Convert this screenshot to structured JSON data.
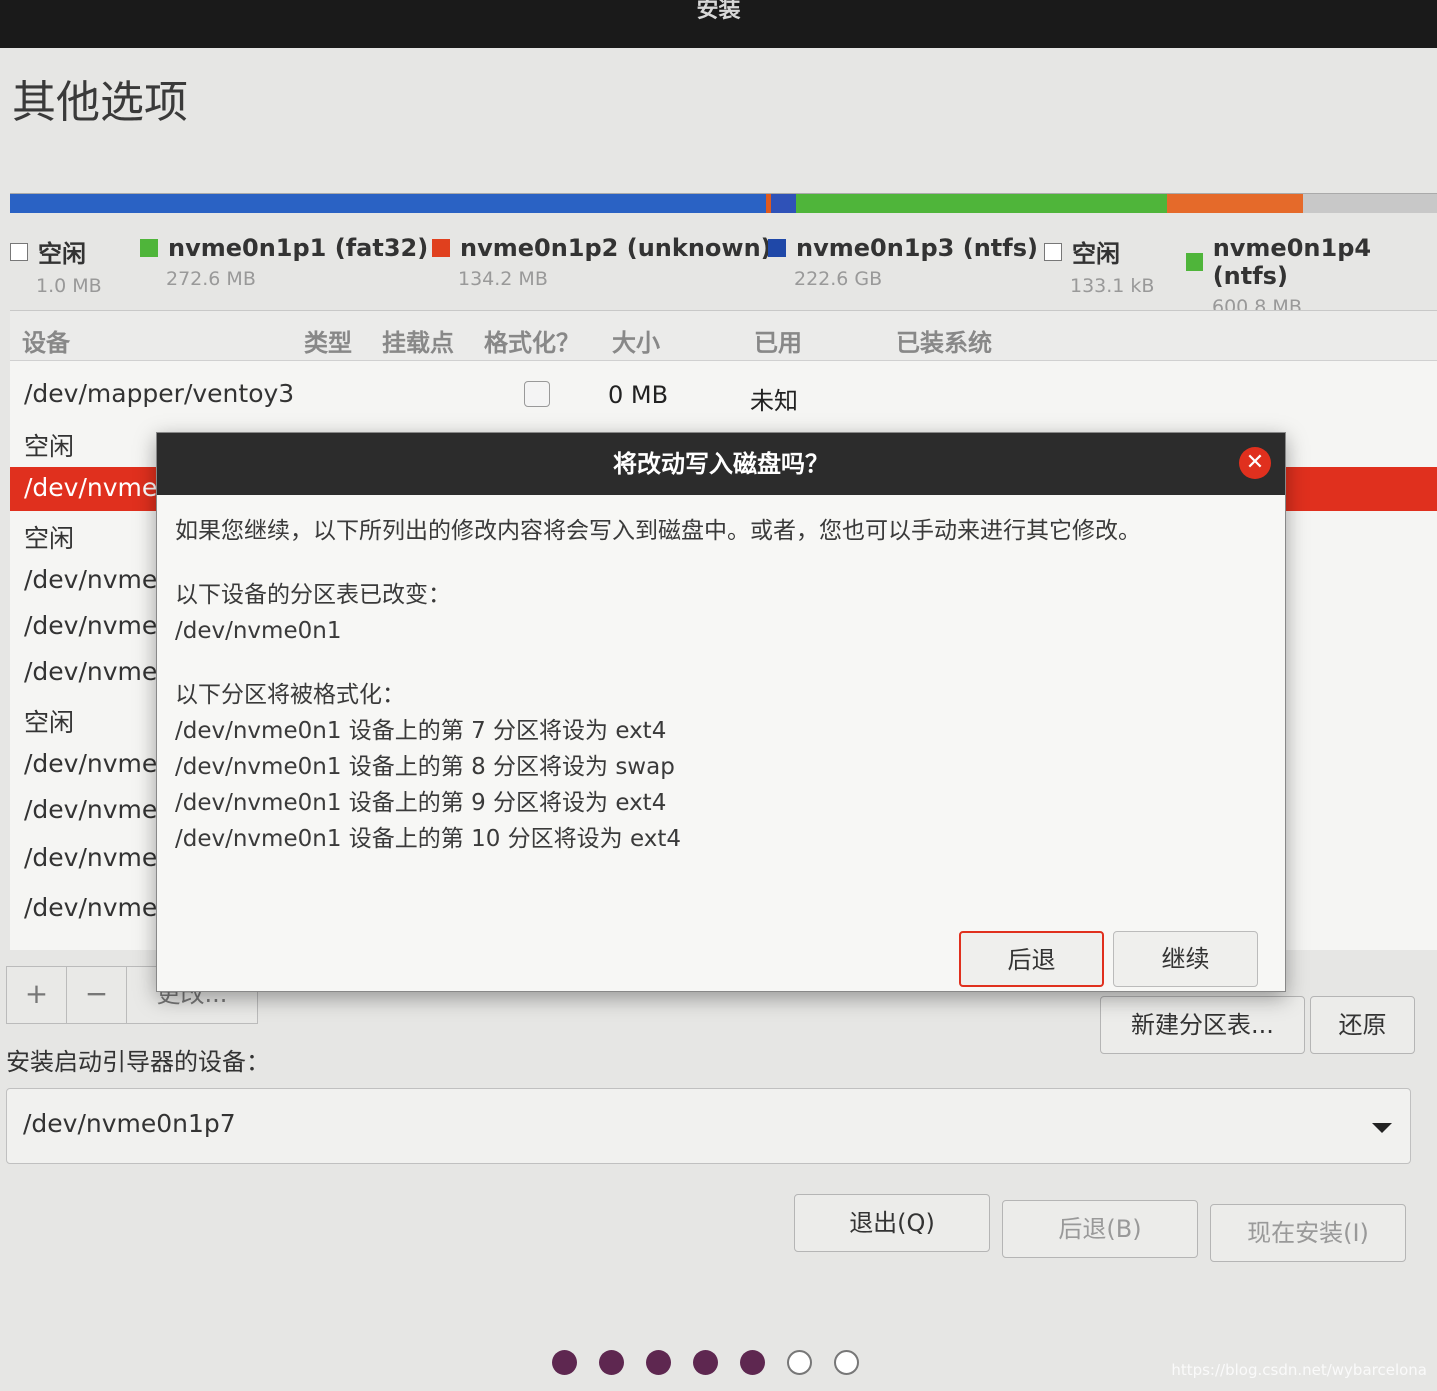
{
  "window": {
    "title": "安装"
  },
  "page": {
    "title": "其他选项"
  },
  "disk_bar": {
    "segments": [
      {
        "color": "#2a62c4",
        "fraction": 0.53
      },
      {
        "color": "#e05a1e",
        "fraction": 0.003
      },
      {
        "color": "#2f52b8",
        "fraction": 0.018
      },
      {
        "color": "#4fb53a",
        "fraction": 0.26
      },
      {
        "color": "#e56a2a",
        "fraction": 0.095
      },
      {
        "color": "#c8c8c8",
        "fraction": 0.094
      }
    ]
  },
  "legend": [
    {
      "name": "空闲",
      "size": "1.0 MB",
      "swatch": "empty",
      "color": "#ffffff"
    },
    {
      "name": "nvme0n1p1 (fat32)",
      "size": "272.6 MB",
      "swatch": "filled",
      "color": "#4fb53a"
    },
    {
      "name": "nvme0n1p2 (unknown)",
      "size": "134.2 MB",
      "swatch": "filled",
      "color": "#e0401e"
    },
    {
      "name": "nvme0n1p3 (ntfs)",
      "size": "222.6 GB",
      "swatch": "filled",
      "color": "#1f48a8"
    },
    {
      "name": "空闲",
      "size": "133.1 kB",
      "swatch": "empty",
      "color": "#ffffff"
    },
    {
      "name": "nvme0n1p4 (ntfs)",
      "size": "600.8 MB",
      "swatch": "filled",
      "color": "#4fb53a"
    }
  ],
  "table": {
    "headers": {
      "device": "设备",
      "type": "类型",
      "mount": "挂载点",
      "format": "格式化？",
      "size": "大小",
      "used": "已用",
      "system": "已装系统"
    },
    "rows": [
      {
        "device": "/dev/mapper/ventoy3",
        "size": "0 MB",
        "used": "未知",
        "selected": false
      },
      {
        "device": "空闲",
        "selected": false
      },
      {
        "device": "/dev/nvme0",
        "selected": true
      },
      {
        "device": "空闲",
        "selected": false
      },
      {
        "device": "/dev/nvme(",
        "selected": false
      },
      {
        "device": "/dev/nvme(",
        "selected": false
      },
      {
        "device": "/dev/nvme(",
        "selected": false
      },
      {
        "device": "空闲",
        "selected": false
      },
      {
        "device": "/dev/nvme(",
        "selected": false
      },
      {
        "device": "/dev/nvme(",
        "selected": false
      },
      {
        "device": "/dev/nvme(",
        "selected": false
      },
      {
        "device": "/dev/nvme(",
        "selected": false
      }
    ]
  },
  "toolbar": {
    "add": "+",
    "remove": "−",
    "change": "更改..."
  },
  "actions": {
    "new_table": "新建分区表...",
    "revert": "还原"
  },
  "boot": {
    "label": "安装启动引导器的设备：",
    "value": "/dev/nvme0n1p7"
  },
  "nav": {
    "quit": "退出(Q)",
    "back": "后退(B)",
    "install": "现在安装(I)"
  },
  "progress": {
    "total": 7,
    "completed": 5
  },
  "dialog": {
    "title": "将改动写入磁盘吗？",
    "intro": "如果您继续，以下所列出的修改内容将会写入到磁盘中。或者，您也可以手动来进行其它修改。",
    "partition_heading": "以下设备的分区表已改变：",
    "partition_device": "/dev/nvme0n1",
    "format_heading": "以下分区将被格式化：",
    "format_lines": [
      "/dev/nvme0n1 设备上的第 7 分区将设为 ext4",
      "/dev/nvme0n1 设备上的第 8 分区将设为 swap",
      "/dev/nvme0n1 设备上的第 9 分区将设为 ext4",
      "/dev/nvme0n1 设备上的第 10 分区将设为 ext4"
    ],
    "back_label": "后退",
    "continue_label": "继续",
    "close_glyph": "✕"
  },
  "watermark": "https://blog.csdn.net/wybarcelona"
}
